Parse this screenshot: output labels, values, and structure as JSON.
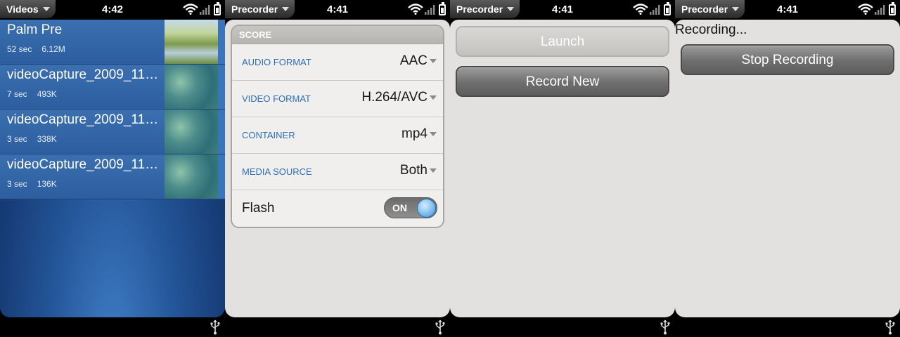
{
  "screens": [
    {
      "app": "Videos",
      "time": "4:42",
      "videos": [
        {
          "title": "Palm Pre",
          "duration": "52 sec",
          "size": "6.12M",
          "thumb": "landscape"
        },
        {
          "title": "videoCapture_2009_11_...",
          "duration": "7 sec",
          "size": "493K",
          "thumb": "bokeh"
        },
        {
          "title": "videoCapture_2009_11_...",
          "duration": "3 sec",
          "size": "338K",
          "thumb": "bokeh"
        },
        {
          "title": "videoCapture_2009_11_...",
          "duration": "3 sec",
          "size": "136K",
          "thumb": "bokeh"
        }
      ]
    },
    {
      "app": "Precorder",
      "time": "4:41",
      "prefs": {
        "header": "SCORE",
        "rows": [
          {
            "label": "AUDIO FORMAT",
            "value": "AAC"
          },
          {
            "label": "VIDEO FORMAT",
            "value": "H.264/AVC"
          },
          {
            "label": "CONTAINER",
            "value": "mp4"
          },
          {
            "label": "MEDIA SOURCE",
            "value": "Both"
          }
        ],
        "flash_label": "Flash",
        "flash_state": "ON"
      }
    },
    {
      "app": "Precorder",
      "time": "4:41",
      "launch_label": "Launch",
      "record_new_label": "Record New"
    },
    {
      "app": "Precorder",
      "time": "4:41",
      "recording_text": "Recording...",
      "stop_label": "Stop Recording"
    }
  ],
  "icons": [
    "wifi-icon",
    "signal-icon",
    "battery-icon",
    "usb-icon",
    "chevron-down-icon"
  ]
}
